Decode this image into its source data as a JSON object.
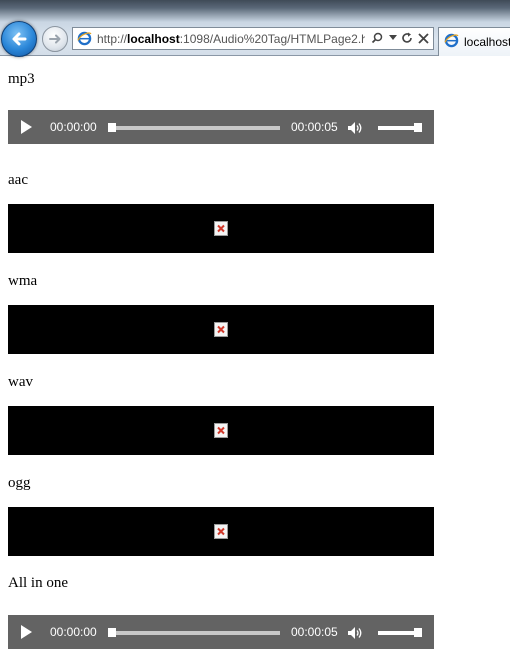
{
  "browser": {
    "back_button": "back",
    "forward_button": "forward",
    "address": {
      "url_prefix": "http://",
      "url_host": "localhost",
      "url_rest": ":1098/Audio%20Tag/HTMLPage2.h"
    },
    "tab": {
      "label": "localhost"
    },
    "icons": {
      "back": "back-arrow-icon",
      "forward": "forward-arrow-icon",
      "page": "ie-page-icon",
      "search": "search-icon",
      "dropdown": "chevron-down-icon",
      "refresh": "refresh-icon",
      "stop": "close-icon"
    }
  },
  "sections": [
    {
      "label": "mp3",
      "kind": "player"
    },
    {
      "label": "aac",
      "kind": "broken"
    },
    {
      "label": "wma",
      "kind": "broken"
    },
    {
      "label": "wav",
      "kind": "broken"
    },
    {
      "label": "ogg",
      "kind": "broken"
    },
    {
      "label": "All in one",
      "kind": "player"
    }
  ],
  "player": {
    "current_time": "00:00:00",
    "total_time": "00:00:05",
    "progress": 0,
    "volume": 1.0,
    "icons": {
      "play": "play-icon",
      "volume": "speaker-icon"
    }
  },
  "broken_media_icon": "broken-media-icon",
  "colors": {
    "player_bg": "#636363",
    "broken_bg": "#000000",
    "broken_icon": "#d0392b"
  }
}
